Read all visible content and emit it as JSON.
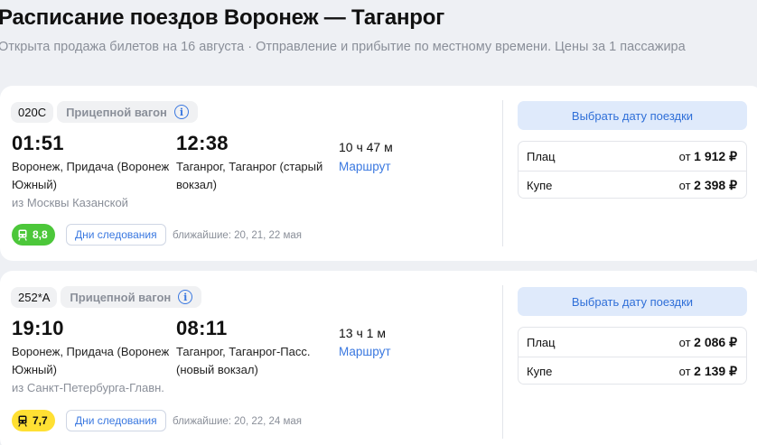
{
  "header": {
    "title": "Расписание поездов Воронеж — Таганрог",
    "subtitle": "Открыта продажа билетов на 16 августа · Отправление и прибытие по местному времени. Цены за 1 пассажира"
  },
  "trains": [
    {
      "number": "020С",
      "type": "Прицепной вагон",
      "departure_time": "01:51",
      "departure_station_line1": "Воронеж, Придача (Воронеж",
      "departure_station_line2": "Южный)",
      "origin_note": "из Москвы Казанской",
      "arrival_time": "12:38",
      "arrival_station_line1": "Таганрог, Таганрог (старый",
      "arrival_station_line2": "вокзал)",
      "duration": "10 ч 47 м",
      "route_label": "Маршрут",
      "rating": "8,8",
      "rating_color": "#4cc73a",
      "days_label": "Дни следования",
      "nearest": "ближайшие: 20, 21, 22 мая",
      "select_date_label": "Выбрать дату поездки",
      "prices": [
        {
          "class": "Плац",
          "from": "от",
          "price": "1 912 ₽"
        },
        {
          "class": "Купе",
          "from": "от",
          "price": "2 398 ₽"
        }
      ]
    },
    {
      "number": "252*А",
      "type": "Прицепной вагон",
      "departure_time": "19:10",
      "departure_station_line1": "Воронеж, Придача (Воронеж",
      "departure_station_line2": "Южный)",
      "origin_note": "из Санкт-Петербурга-Главн.",
      "arrival_time": "08:11",
      "arrival_station_line1": "Таганрог, Таганрог-Пасс.",
      "arrival_station_line2": "(новый вокзал)",
      "duration": "13 ч 1 м",
      "route_label": "Маршрут",
      "rating": "7,7",
      "rating_color": "#ffe033",
      "days_label": "Дни следования",
      "nearest": "ближайшие: 20, 22, 24 мая",
      "select_date_label": "Выбрать дату поездки",
      "prices": [
        {
          "class": "Плац",
          "from": "от",
          "price": "2 086 ₽"
        },
        {
          "class": "Купе",
          "from": "от",
          "price": "2 139 ₽"
        }
      ]
    }
  ]
}
